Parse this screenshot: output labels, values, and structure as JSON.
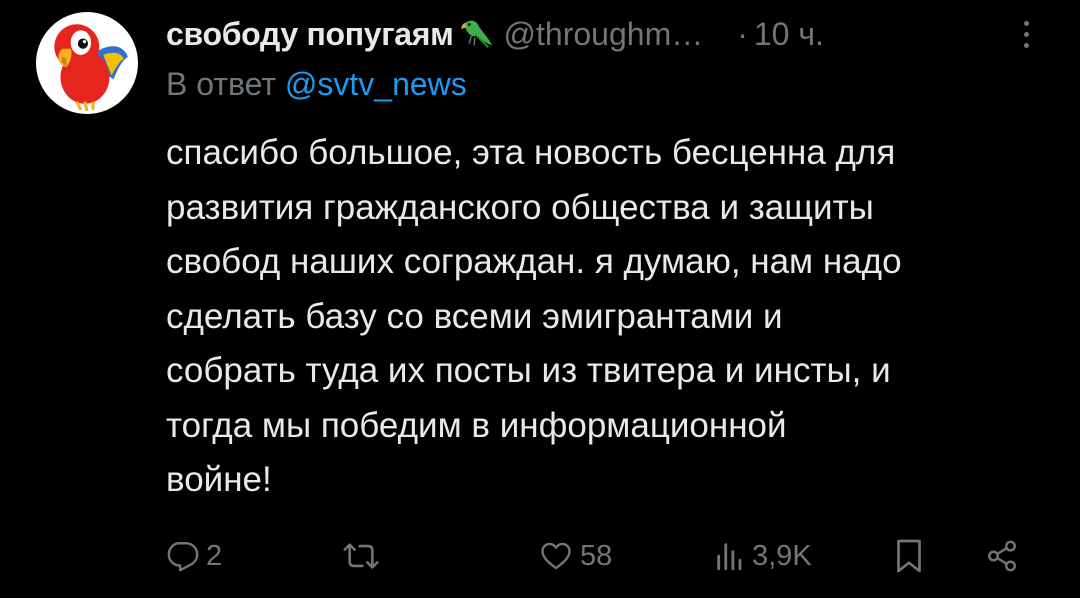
{
  "tweet": {
    "author_name": "свободу попугаям",
    "handle": "@throughm…",
    "separator": "·",
    "time": "10 ч.",
    "reply_prefix": "В ответ",
    "reply_mention": "@svtv_news",
    "text": "спасибо большое, эта новость бесценна для\nразвития гражданского общества и защиты\nсвобод наших сограждан. я думаю, нам надо\nсделать базу со всеми эмигрантами и\nсобрать туда их посты из твитера и инсты, и\nтогда мы победим в информационной\nвойне!"
  },
  "actions": {
    "reply_count": "2",
    "retweet_count": "",
    "like_count": "58",
    "views_count": "3,9K"
  },
  "icons": {
    "avatar": "parrot-avatar",
    "name_emoji": "parrot-emoji",
    "more": "more-icon",
    "reply": "reply-icon",
    "retweet": "retweet-icon",
    "like": "heart-icon",
    "views": "views-icon",
    "bookmark": "bookmark-icon",
    "share": "share-icon"
  },
  "colors": {
    "background": "#000000",
    "text": "#e7e9ea",
    "muted": "#71767b",
    "link": "#1d9bf0"
  }
}
